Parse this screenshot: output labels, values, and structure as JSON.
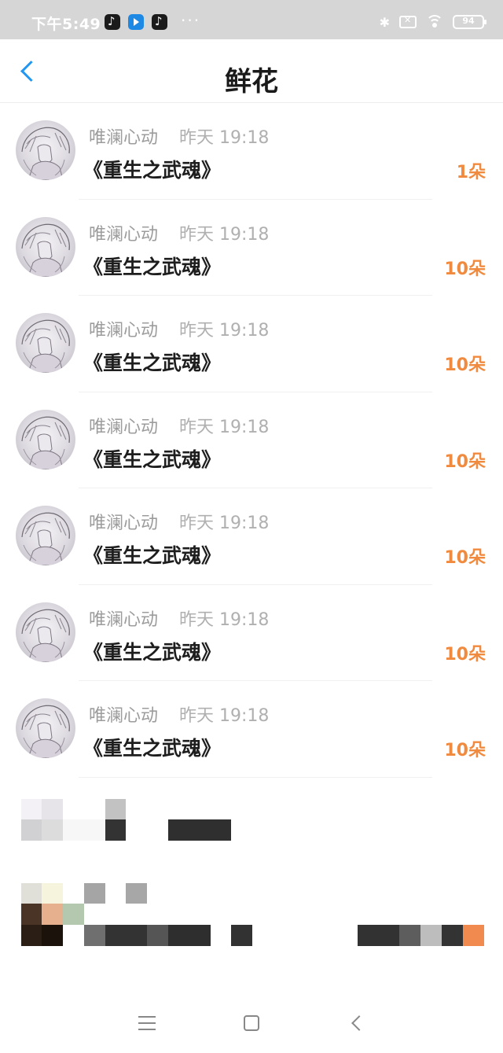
{
  "status_bar": {
    "time": "下午5:49",
    "more": "···",
    "battery": "94",
    "icons": [
      "tiktok-icon",
      "bilibili-icon",
      "tiktok-icon",
      "bluetooth-icon",
      "no-sim-icon",
      "wifi-icon",
      "battery-icon"
    ]
  },
  "header": {
    "title": "鲜花",
    "back_icon": "chevron-left-icon",
    "accent_color": "#2196f3"
  },
  "records": [
    {
      "user": "唯澜心动",
      "time": "昨天 19:18",
      "book": "《重生之武魂》",
      "quantity": "1朵"
    },
    {
      "user": "唯澜心动",
      "time": "昨天 19:18",
      "book": "《重生之武魂》",
      "quantity": "10朵"
    },
    {
      "user": "唯澜心动",
      "time": "昨天 19:18",
      "book": "《重生之武魂》",
      "quantity": "10朵"
    },
    {
      "user": "唯澜心动",
      "time": "昨天 19:18",
      "book": "《重生之武魂》",
      "quantity": "10朵"
    },
    {
      "user": "唯澜心动",
      "time": "昨天 19:18",
      "book": "《重生之武魂》",
      "quantity": "10朵"
    },
    {
      "user": "唯澜心动",
      "time": "昨天 19:18",
      "book": "《重生之武魂》",
      "quantity": "10朵"
    },
    {
      "user": "唯澜心动",
      "time": "昨天 19:18",
      "book": "《重生之武魂》",
      "quantity": "10朵"
    }
  ],
  "colors": {
    "quantity": "#f08a3e",
    "username": "#9c9c9c",
    "time": "#b0b0b0"
  },
  "nav_bar": {
    "icons": [
      "menu-icon",
      "home-icon",
      "back-icon"
    ]
  }
}
